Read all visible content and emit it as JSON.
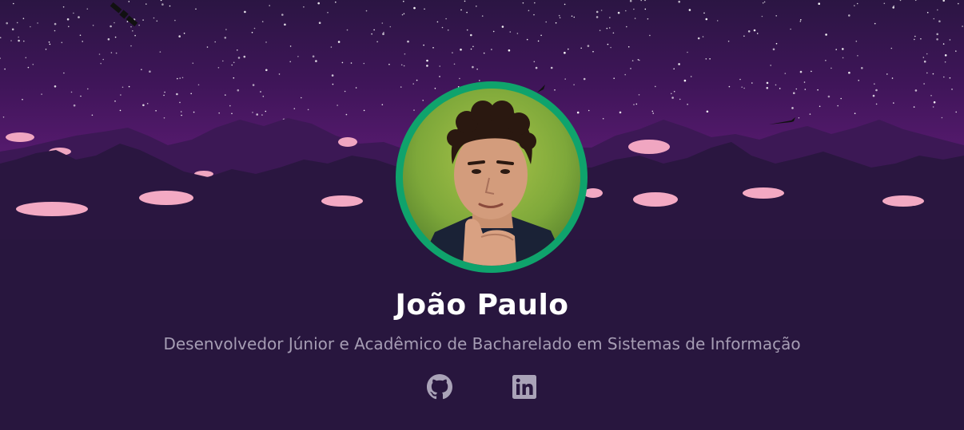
{
  "profile": {
    "name": "João Paulo",
    "subtitle": "Desenvolvedor Júnior e Acadêmico de Bacharelado em Sistemas de Informação",
    "avatar_alt": "profile-photo"
  },
  "socials": [
    {
      "icon": "github-icon",
      "name": "GitHub"
    },
    {
      "icon": "linkedin-icon",
      "name": "LinkedIn"
    }
  ],
  "colors": {
    "background": "#28163e",
    "sky_top": "#2d1646",
    "sky_bottom": "#5c1a73",
    "mountains_far": "#3b1854",
    "mountains_near": "#28163e",
    "clouds": "#f2a7c2",
    "avatar_ring": "#0fa36c",
    "name": "#ffffff",
    "subtitle": "#a69db4",
    "icons": "#aaa3b8"
  }
}
